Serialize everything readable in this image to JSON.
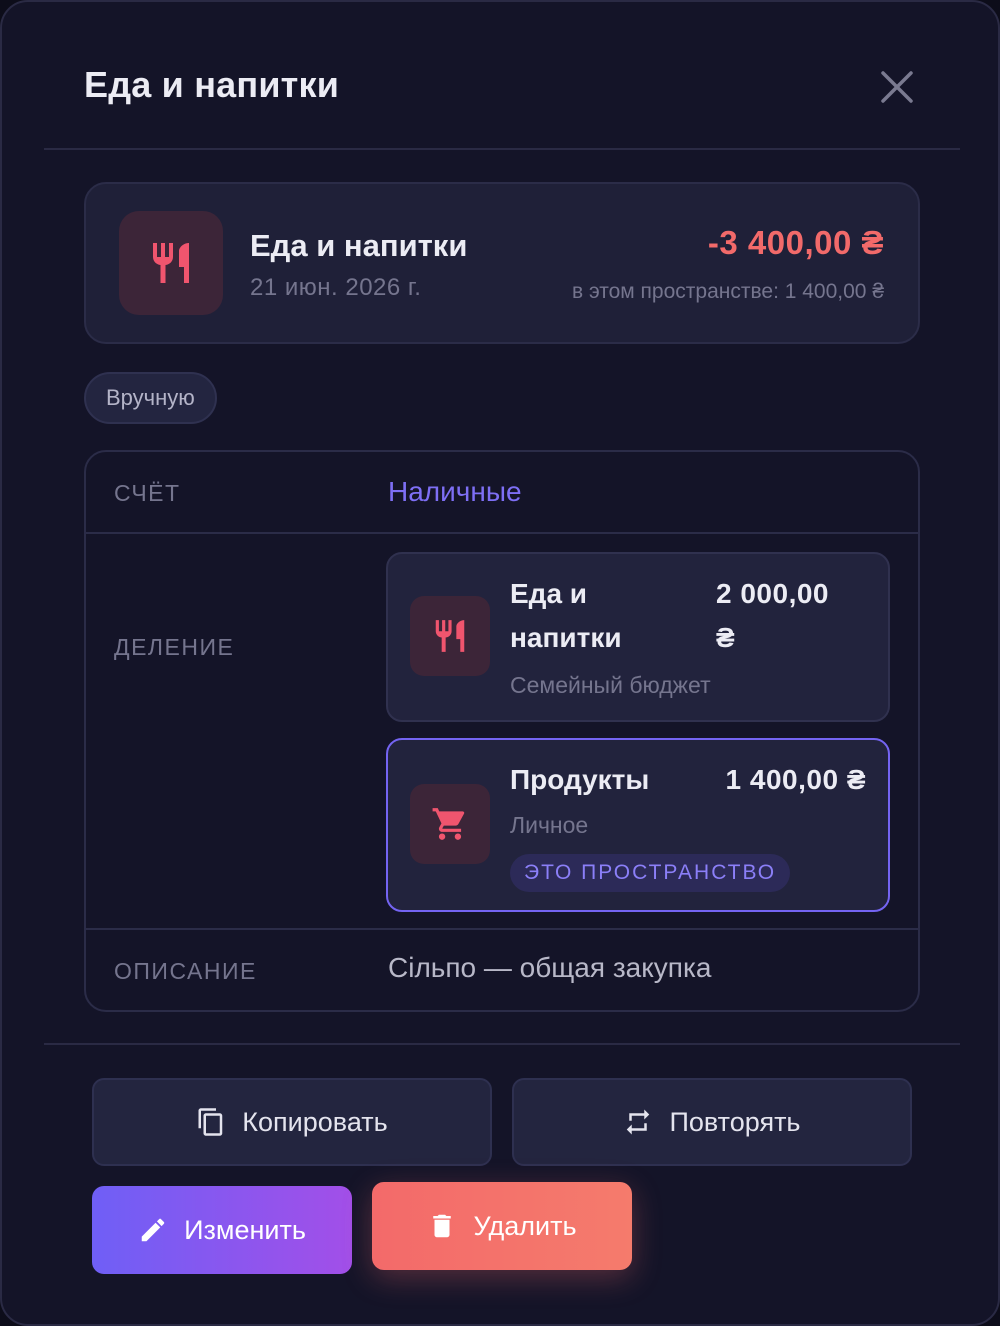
{
  "modal": {
    "title": "Еда и напитки"
  },
  "summary": {
    "category": "Еда и напитки",
    "date": "21 июн. 2026 г.",
    "amount": "-3 400,00 ₴",
    "in_space": "в этом пространстве: 1 400,00 ₴",
    "icon": "fork-knife-icon"
  },
  "source_chip": "Вручную",
  "details": {
    "account_label": "СЧЁТ",
    "account_value": "Наличные",
    "split_label": "ДЕЛЕНИЕ",
    "splits": [
      {
        "name_line1": "Еда и",
        "name_line2": "напитки",
        "amount_line1": "2 000,00",
        "amount_line2": "₴",
        "space": "Семейный бюджет",
        "icon": "fork-knife-icon"
      },
      {
        "name": "Продукты",
        "amount": "1 400,00 ₴",
        "space": "Личное",
        "badge": "ЭТО ПРОСТРАНСТВО",
        "icon": "shopping-cart-icon"
      }
    ],
    "description_label": "ОПИСАНИЕ",
    "description_value": "Сільпо — общая закупка"
  },
  "actions": {
    "copy": "Копировать",
    "repeat": "Повторять",
    "edit": "Изменить",
    "delete": "Удалить"
  },
  "colors": {
    "expense": "#f26a6a",
    "accent": "#7464f2",
    "icon_tint": "#f0556e"
  }
}
